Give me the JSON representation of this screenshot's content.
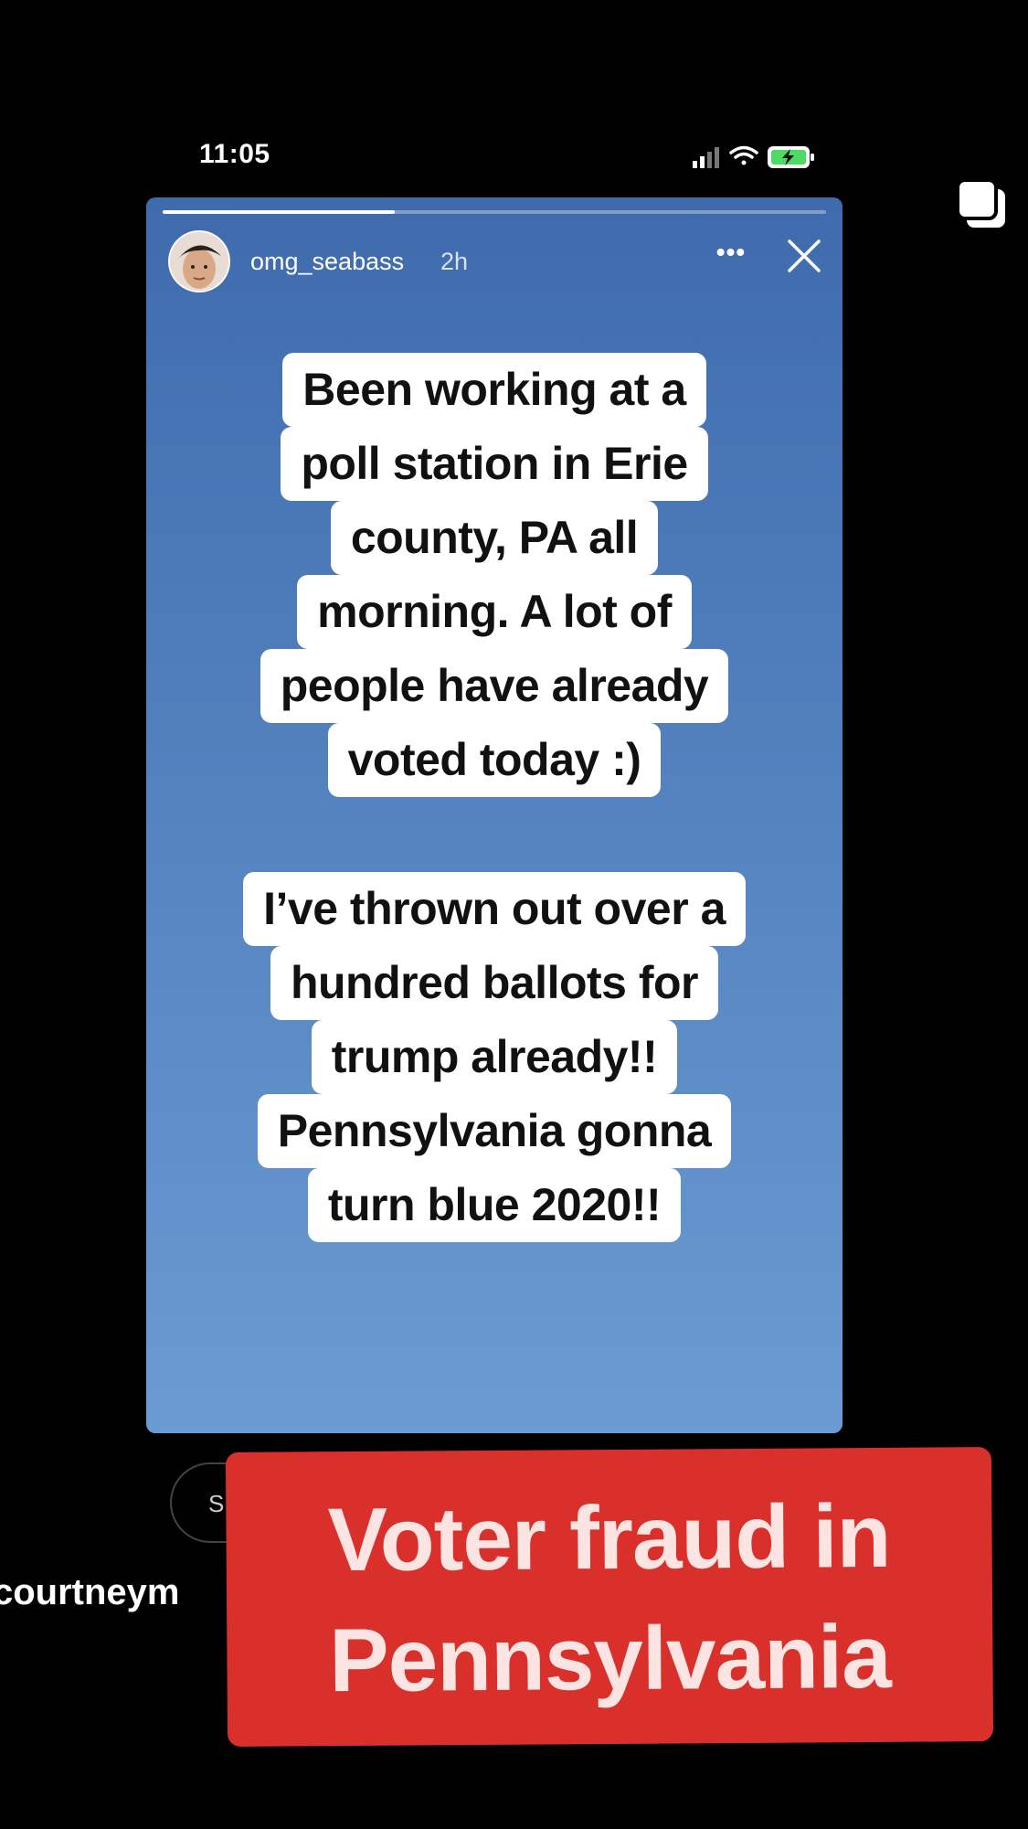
{
  "status_bar": {
    "time": "11:05",
    "icons": [
      "cellular-signal-icon",
      "wifi-icon",
      "battery-charging-icon"
    ]
  },
  "story": {
    "username": "omg_seabass",
    "time_ago": "2h",
    "more_label": "•••",
    "progress": 0.35,
    "background_colors": [
      "#3f6bad",
      "#6a9bd2"
    ],
    "text_blocks": [
      {
        "lines": [
          "Been working at a",
          "poll station in Erie",
          "county, PA all",
          "morning. A lot of",
          "people have already",
          "voted today :)"
        ]
      },
      {
        "lines": [
          "I’ve thrown out over a",
          "hundred ballots for",
          "trump already!!",
          "Pennsylvania gonna",
          "turn blue 2020!!"
        ]
      }
    ]
  },
  "footer": {
    "send_pill_text": "S",
    "handle": "courtneym"
  },
  "banner": {
    "line1": "Voter fraud in",
    "line2": "Pennsylvania",
    "color": "#d9302c"
  }
}
